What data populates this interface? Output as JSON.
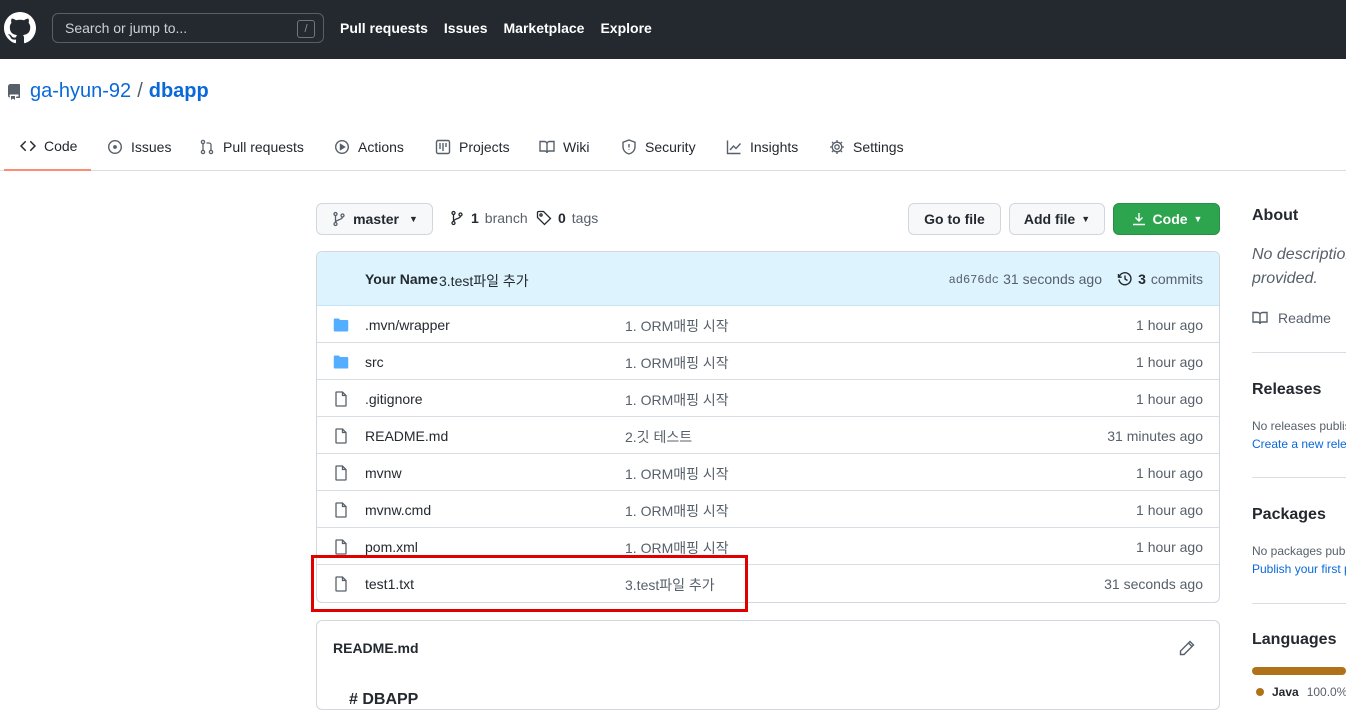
{
  "header": {
    "search_placeholder": "Search or jump to...",
    "search_key": "/",
    "nav": [
      "Pull requests",
      "Issues",
      "Marketplace",
      "Explore"
    ]
  },
  "repo": {
    "owner": "ga-hyun-92",
    "separator": "/",
    "name": "dbapp"
  },
  "tabs": [
    {
      "label": "Code",
      "icon": "code-icon"
    },
    {
      "label": "Issues",
      "icon": "issue-icon"
    },
    {
      "label": "Pull requests",
      "icon": "pull-request-icon"
    },
    {
      "label": "Actions",
      "icon": "play-icon"
    },
    {
      "label": "Projects",
      "icon": "project-icon"
    },
    {
      "label": "Wiki",
      "icon": "book-icon"
    },
    {
      "label": "Security",
      "icon": "shield-icon"
    },
    {
      "label": "Insights",
      "icon": "graph-icon"
    },
    {
      "label": "Settings",
      "icon": "gear-icon"
    }
  ],
  "controls": {
    "branch": "master",
    "branch_count": "1",
    "branch_label": "branch",
    "tag_count": "0",
    "tag_label": "tags",
    "go_to_file": "Go to file",
    "add_file": "Add file",
    "code": "Code"
  },
  "latest_commit": {
    "author": "Your Name",
    "message": "3.test파일 추가",
    "sha": "ad676dc",
    "time": "31 seconds ago",
    "commit_count": "3",
    "commit_label": "commits"
  },
  "files": [
    {
      "name": ".mvn/wrapper",
      "type": "folder",
      "message": "1. ORM매핑 시작",
      "age": "1 hour ago"
    },
    {
      "name": "src",
      "type": "folder",
      "message": "1. ORM매핑 시작",
      "age": "1 hour ago"
    },
    {
      "name": ".gitignore",
      "type": "file",
      "message": "1. ORM매핑 시작",
      "age": "1 hour ago"
    },
    {
      "name": "README.md",
      "type": "file",
      "message": "2.깃 테스트",
      "age": "31 minutes ago"
    },
    {
      "name": "mvnw",
      "type": "file",
      "message": "1. ORM매핑 시작",
      "age": "1 hour ago"
    },
    {
      "name": "mvnw.cmd",
      "type": "file",
      "message": "1. ORM매핑 시작",
      "age": "1 hour ago"
    },
    {
      "name": "pom.xml",
      "type": "file",
      "message": "1. ORM매핑 시작",
      "age": "1 hour ago"
    },
    {
      "name": "test1.txt",
      "type": "file",
      "message": "3.test파일 추가",
      "age": "31 seconds ago"
    }
  ],
  "readme": {
    "title": "README.md",
    "peek": "# DBAPP"
  },
  "sidebar": {
    "about": "About",
    "no_description_1": "No description",
    "no_description_2": "provided.",
    "readme_link": "Readme",
    "releases": "Releases",
    "releases_text": "No releases published",
    "releases_link": "Create a new release",
    "packages": "Packages",
    "packages_text": "No packages published",
    "packages_link": "Publish your first package",
    "languages": "Languages",
    "lang_name": "Java",
    "lang_pct": "100.0%"
  },
  "colors": {
    "header_bg": "#24292f",
    "accent": "#0969da",
    "green": "#2da44e",
    "highlight": "#e00000",
    "java": "#b07219"
  }
}
